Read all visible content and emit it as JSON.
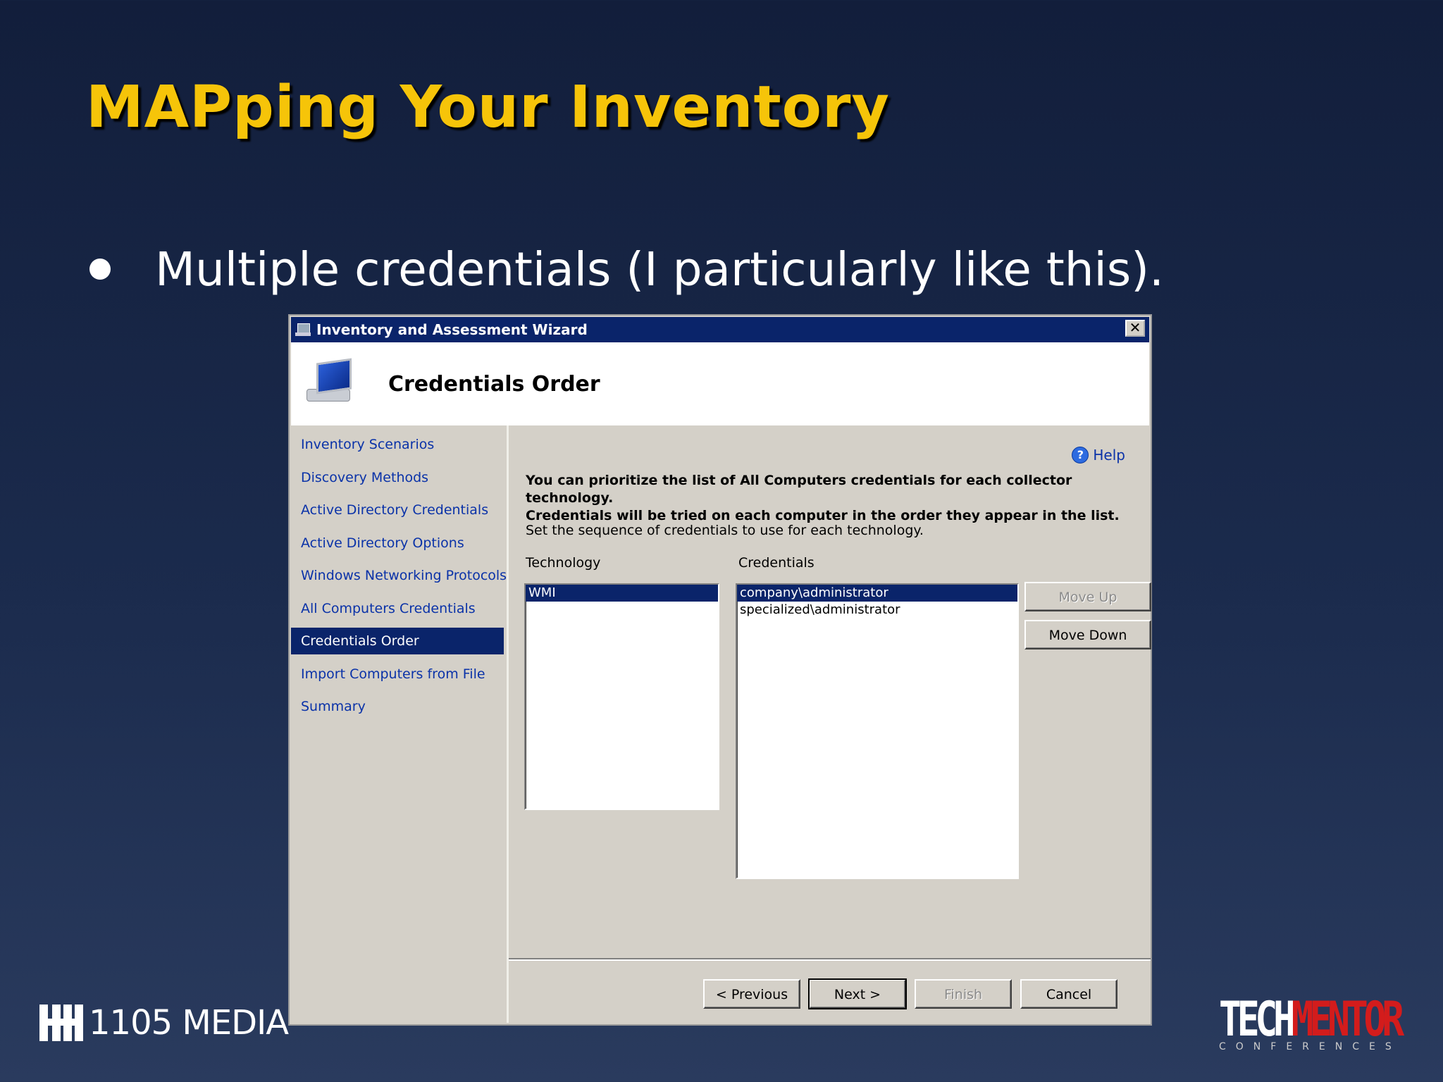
{
  "slide": {
    "title": "MAPping Your Inventory",
    "bullet": "Multiple credentials (I particularly like this)."
  },
  "dialog": {
    "window_title": "Inventory and Assessment Wizard",
    "close_label": "✕",
    "page_title": "Credentials Order",
    "nav_items": [
      {
        "label": "Inventory Scenarios",
        "active": false
      },
      {
        "label": "Discovery Methods",
        "active": false
      },
      {
        "label": "Active Directory Credentials",
        "active": false
      },
      {
        "label": "Active Directory Options",
        "active": false
      },
      {
        "label": "Windows Networking Protocols",
        "active": false
      },
      {
        "label": "All Computers Credentials",
        "active": false
      },
      {
        "label": "Credentials Order",
        "active": true
      },
      {
        "label": "Import Computers from File",
        "active": false
      },
      {
        "label": "Summary",
        "active": false
      }
    ],
    "help_label": "Help",
    "description_line1": "You can prioritize the list of All Computers credentials for each collector technology.",
    "description_line2": "Credentials will be tried on each computer in the order they appear in the list.",
    "instruction": "Set the sequence of credentials to use for each technology.",
    "technology_label": "Technology",
    "credentials_label": "Credentials",
    "technology_items": [
      {
        "label": "WMI",
        "selected": true
      }
    ],
    "credential_items": [
      {
        "label": "company\\administrator",
        "selected": true
      },
      {
        "label": "specialized\\administrator",
        "selected": false
      }
    ],
    "move_up_label": "Move Up",
    "move_down_label": "Move Down",
    "previous_label": "< Previous",
    "next_label": "Next >",
    "finish_label": "Finish",
    "cancel_label": "Cancel"
  },
  "logos": {
    "media_text": "1105 MEDIA",
    "techmentor_tech": "TECH",
    "techmentor_mentor": "MENTOR",
    "techmentor_sub": "CONFERENCES"
  },
  "colors": {
    "title_yellow": "#f6c409",
    "selection_blue": "#0a246a",
    "link_blue": "#0a32a8",
    "dialog_gray": "#d4d0c8",
    "mentor_red": "#d31c1c"
  }
}
